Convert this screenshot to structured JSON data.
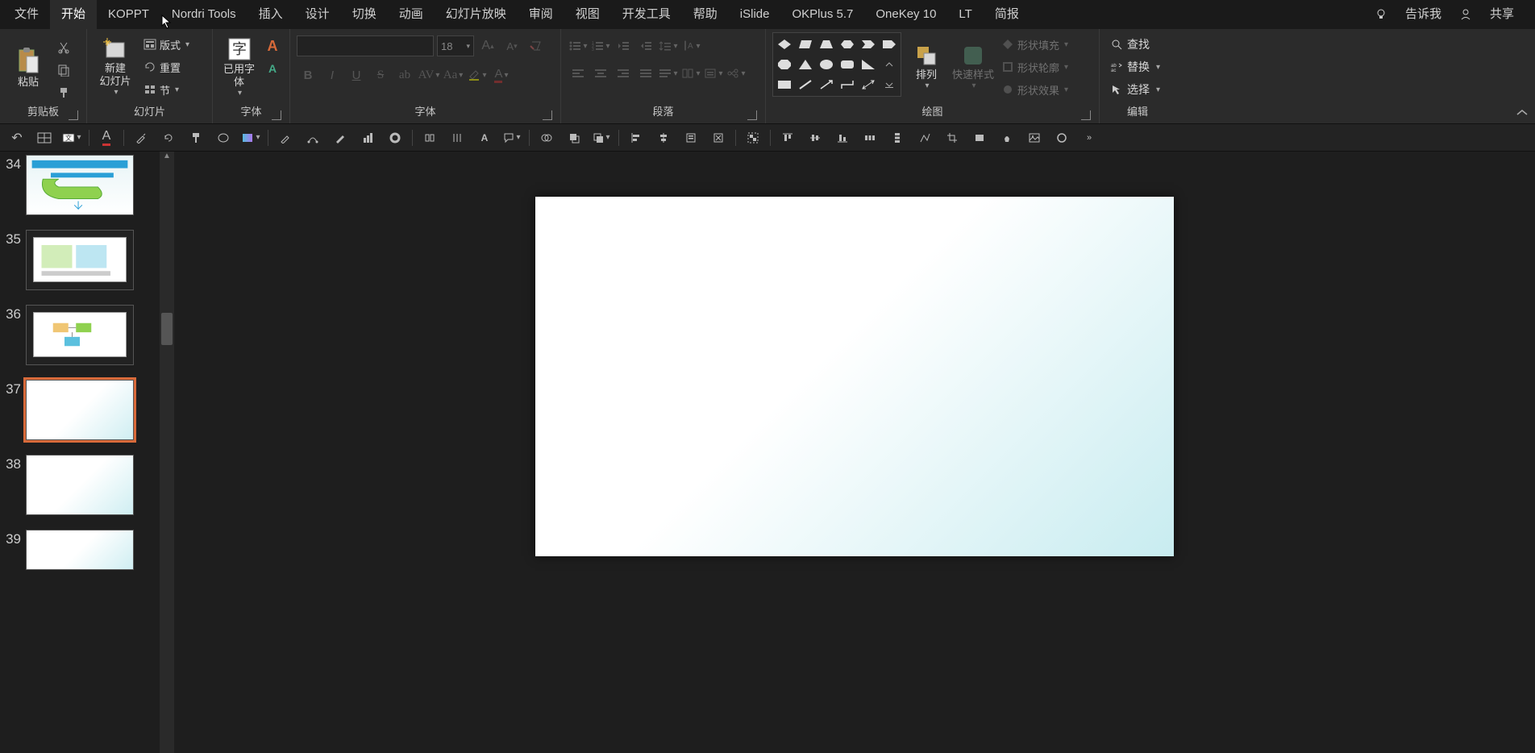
{
  "tabs": {
    "file": "文件",
    "home": "开始",
    "koppt": "KOPPT",
    "nordri": "Nordri Tools",
    "insert": "插入",
    "design": "设计",
    "transition": "切换",
    "animation": "动画",
    "slideshow": "幻灯片放映",
    "review": "审阅",
    "view": "视图",
    "devtools": "开发工具",
    "help": "帮助",
    "islide": "iSlide",
    "okplus": "OKPlus 5.7",
    "onekey": "OneKey 10",
    "lt": "LT",
    "brief": "简报",
    "tellme": "告诉我",
    "share": "共享"
  },
  "ribbon": {
    "clipboard": {
      "paste": "粘贴",
      "label": "剪贴板"
    },
    "slides": {
      "new": "新建\n幻灯片",
      "layout": "版式",
      "reset": "重置",
      "section": "节",
      "label": "幻灯片"
    },
    "usedfont": {
      "btn": "已用字\n体",
      "label": "字体"
    },
    "font": {
      "size": "18",
      "label": "字体"
    },
    "paragraph": {
      "label": "段落"
    },
    "drawing": {
      "arrange": "排列",
      "quickstyle": "快速样式",
      "fill": "形状填充",
      "outline": "形状轮廓",
      "effects": "形状效果",
      "label": "绘图"
    },
    "editing": {
      "find": "查找",
      "replace": "替换",
      "select": "选择",
      "label": "编辑"
    }
  },
  "thumbs": [
    {
      "num": "34"
    },
    {
      "num": "35"
    },
    {
      "num": "36"
    },
    {
      "num": "37"
    },
    {
      "num": "38"
    },
    {
      "num": "39"
    }
  ]
}
